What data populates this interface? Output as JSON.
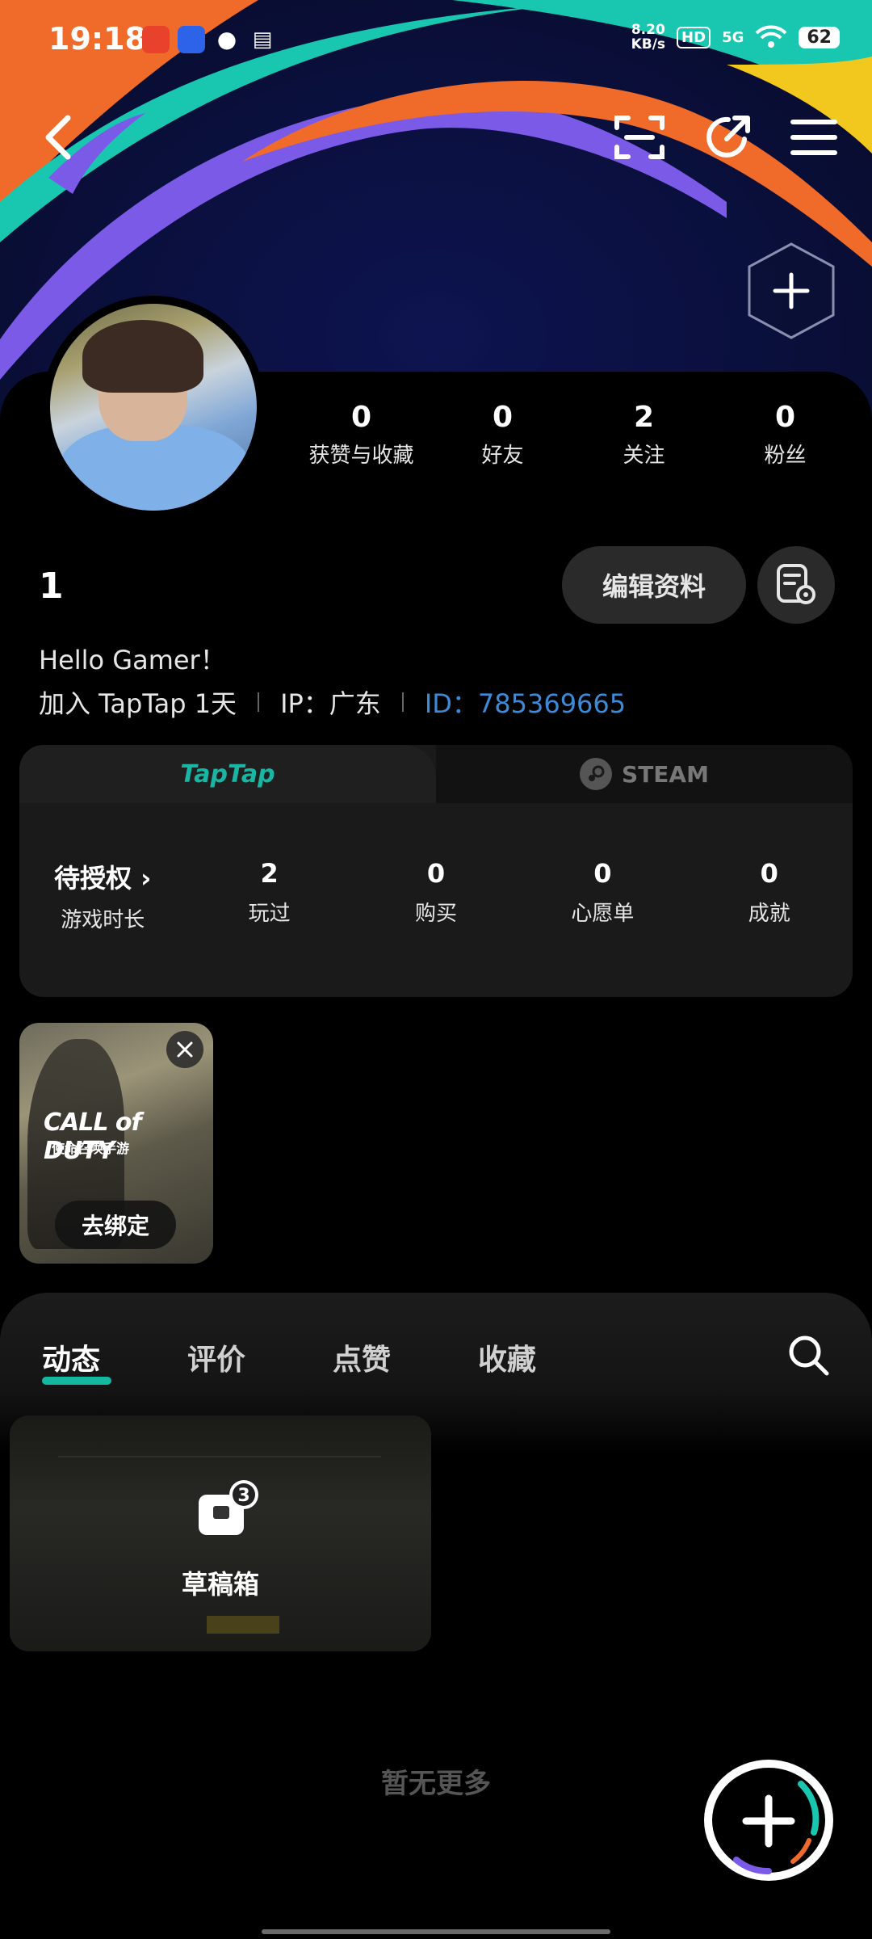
{
  "status_bar": {
    "time": "19:18",
    "net_speed_value": "8.20",
    "net_speed_unit": "KB/s",
    "hd": "HD",
    "signal": "5G",
    "battery": "62"
  },
  "header": {
    "back_icon": "chevron-left-icon",
    "scan_icon": "scan-icon",
    "share_icon": "share-icon",
    "menu_icon": "menu-icon",
    "add_icon": "plus-icon"
  },
  "profile": {
    "stats": [
      {
        "value": "0",
        "label": "获赞与收藏"
      },
      {
        "value": "0",
        "label": "好友"
      },
      {
        "value": "2",
        "label": "关注"
      },
      {
        "value": "0",
        "label": "粉丝"
      }
    ],
    "username": "1",
    "edit_label": "编辑资料",
    "bio": "Hello Gamer！",
    "joined": "加入 TapTap 1天",
    "ip": "IP：广东",
    "id": "ID：785369665"
  },
  "platforms": {
    "tabs": [
      "TapTap",
      "STEAM"
    ],
    "active_tab": "TapTap",
    "stats": [
      {
        "value": "待授权 ›",
        "label": "游戏时长"
      },
      {
        "value": "2",
        "label": "玩过"
      },
      {
        "value": "0",
        "label": "购买"
      },
      {
        "value": "0",
        "label": "心愿单"
      },
      {
        "value": "0",
        "label": "成就"
      }
    ]
  },
  "bind_tile": {
    "game_title": "CALL of DUTY",
    "game_subtitle": "使命召唤手游",
    "bind_label": "去绑定"
  },
  "feed": {
    "tabs": [
      "动态",
      "评价",
      "点赞",
      "收藏"
    ],
    "active_tab": "动态",
    "draft_label": "草稿箱",
    "draft_count": "3",
    "empty_text": "暂无更多"
  },
  "colors": {
    "accent": "#14b8a0",
    "id_link": "#3d8bd8",
    "background": "#000000"
  }
}
